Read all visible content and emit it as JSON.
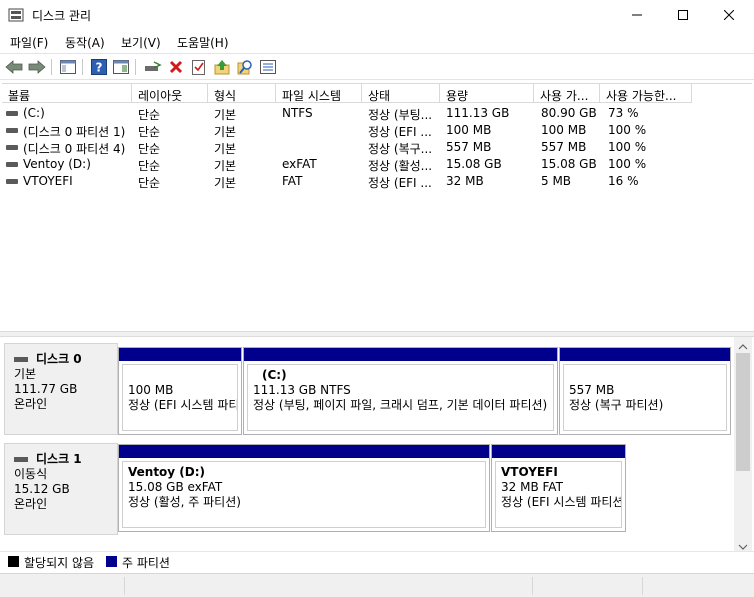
{
  "window": {
    "title": "디스크 관리",
    "icon": "disk-management-icon",
    "controls": [
      "minimize-icon",
      "maximize-icon",
      "close-icon"
    ]
  },
  "menu": {
    "file": "파일(F)",
    "action": "동작(A)",
    "view": "보기(V)",
    "help": "도움말(H)"
  },
  "toolbar": {
    "icons": [
      "back-arrow-icon",
      "forward-arrow-icon",
      "console-tree-icon",
      "help-icon",
      "details-pane-icon",
      "connect-drive-icon",
      "delete-icon",
      "properties-check-icon",
      "up-arrow-icon",
      "search-icon",
      "list-view-icon"
    ]
  },
  "volume_table": {
    "columns": [
      "볼륨",
      "레이아웃",
      "형식",
      "파일 시스템",
      "상태",
      "용량",
      "사용 가...",
      "사용 가능한..."
    ],
    "rows": [
      {
        "volume": " (C:)",
        "layout": "단순",
        "type": "기본",
        "fs": "NTFS",
        "status": "정상 (부팅...",
        "capacity": "111.13 GB",
        "free": "80.90 GB",
        "pct": "73 %"
      },
      {
        "volume": "(디스크 0 파티션 1)",
        "layout": "단순",
        "type": "기본",
        "fs": "",
        "status": "정상 (EFI ...",
        "capacity": "100 MB",
        "free": "100 MB",
        "pct": "100 %"
      },
      {
        "volume": "(디스크 0 파티션 4)",
        "layout": "단순",
        "type": "기본",
        "fs": "",
        "status": "정상 (복구...",
        "capacity": "557 MB",
        "free": "557 MB",
        "pct": "100 %"
      },
      {
        "volume": "Ventoy (D:)",
        "layout": "단순",
        "type": "기본",
        "fs": "exFAT",
        "status": "정상 (활성...",
        "capacity": "15.08 GB",
        "free": "15.08 GB",
        "pct": "100 %"
      },
      {
        "volume": "VTOYEFI",
        "layout": "단순",
        "type": "기본",
        "fs": "FAT",
        "status": "정상 (EFI ...",
        "capacity": "32 MB",
        "free": "5 MB",
        "pct": "16 %"
      }
    ]
  },
  "disks": [
    {
      "name": "디스크 0",
      "kind": "기본",
      "size": "111.77 GB",
      "state": "온라인",
      "partitions": [
        {
          "title": "",
          "line1": "100 MB",
          "line2": "정상 (EFI 시스템 파티션)"
        },
        {
          "title": "(C:)",
          "line1": "111.13 GB NTFS",
          "line2": "정상 (부팅, 페이지 파일, 크래시 덤프, 기본 데이터 파티션)"
        },
        {
          "title": "",
          "line1": "557 MB",
          "line2": "정상 (복구 파티션)"
        }
      ]
    },
    {
      "name": "디스크 1",
      "kind": "이동식",
      "size": "15.12 GB",
      "state": "온라인",
      "partitions": [
        {
          "title": "Ventoy  (D:)",
          "line1": "15.08 GB exFAT",
          "line2": "정상 (활성, 주 파티션)"
        },
        {
          "title": "VTOYEFI",
          "line1": "32 MB FAT",
          "line2": "정상 (EFI 시스템 파티션)"
        }
      ]
    }
  ],
  "legend": {
    "unallocated": "할당되지 않음",
    "primary": "주 파티션",
    "unallocated_color": "#000000",
    "primary_color": "#00008c"
  }
}
